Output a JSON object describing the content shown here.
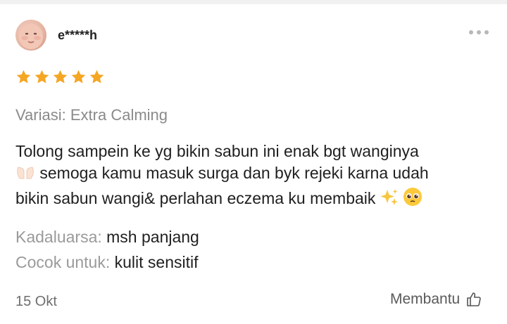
{
  "review": {
    "username": "e*****h",
    "rating": 5,
    "variant_label": "Variasi:",
    "variant_value": "Extra Calming",
    "text_line1": "Tolong sampein ke yg bikin sabun ini enak bgt wanginya",
    "text_line2": "semoga kamu masuk surga dan byk rejeki karna udah",
    "text_line3": "bikin sabun wangi& perlahan eczema ku membaik",
    "expiry_label": "Kadaluarsa:",
    "expiry_value": "msh panjang",
    "suitable_label": "Cocok untuk:",
    "suitable_value": "kulit sensitif",
    "date": "15 Okt",
    "helpful_label": "Membantu"
  },
  "icons": {
    "avatar": "baby-avatar",
    "more": "more-dots-icon",
    "star": "star-icon",
    "hands": "open-hands-emoji",
    "sparkles": "sparkles-emoji",
    "pleading": "pleading-face-emoji",
    "thumbs": "thumbs-up-icon"
  },
  "colors": {
    "star": "#F5A623",
    "muted_text": "#8a8a8a",
    "body_text": "#1f1f1f"
  }
}
